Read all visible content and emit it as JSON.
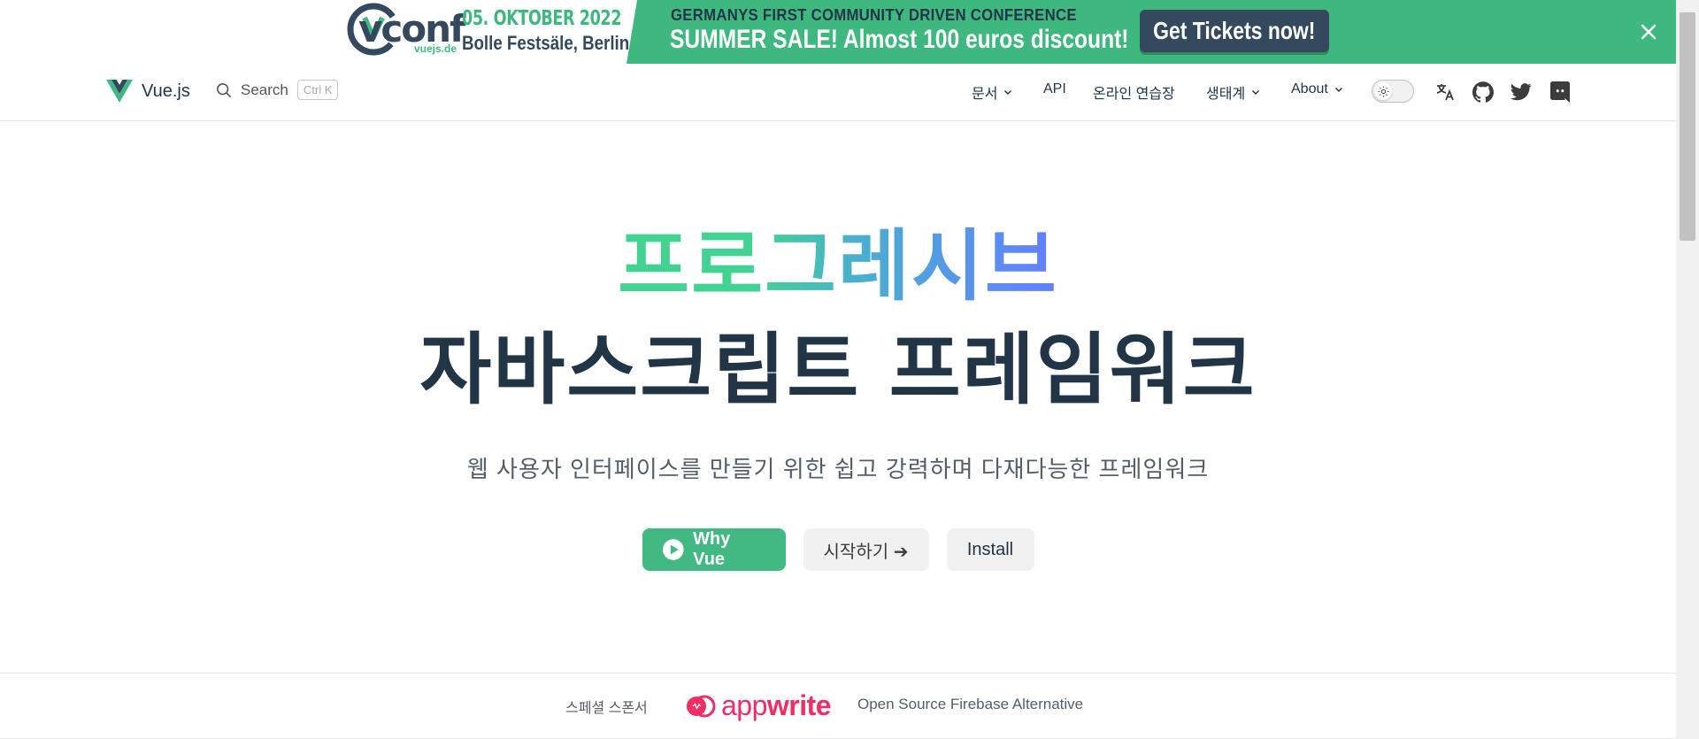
{
  "banner": {
    "logo_text": "vconf",
    "logo_sub": "vuejs.de",
    "date": "05. OKTOBER 2022",
    "venue": "Bolle Festsäle, Berlin",
    "tagline": "GERMANYS FIRST COMMUNITY DRIVEN CONFERENCE",
    "sale": "SUMMER SALE! Almost 100 euros discount!",
    "cta_label": "Get Tickets now!",
    "accent_color": "#3fb880"
  },
  "navbar": {
    "brand": "Vue.js",
    "search_label": "Search",
    "search_shortcut": "Ctrl K",
    "items": [
      {
        "label": "문서",
        "dropdown": true
      },
      {
        "label": "API",
        "dropdown": false
      },
      {
        "label": "온라인 연습장",
        "dropdown": false
      },
      {
        "label": "생태계",
        "dropdown": true
      },
      {
        "label": "About",
        "dropdown": true
      }
    ],
    "icons": [
      "sun-icon",
      "translate-icon",
      "github-icon",
      "twitter-icon",
      "discord-icon"
    ]
  },
  "hero": {
    "tagline": "프로그레시브",
    "title": "자바스크립트 프레임워크",
    "description": "웹 사용자 인터페이스를 만들기 위한 쉽고 강력하며 다재다능한 프레임워크",
    "actions": {
      "why": "Why Vue",
      "start": "시작하기 ➔",
      "install": "Install"
    }
  },
  "sponsor": {
    "label": "스페셜 스폰서",
    "brand_light": "app",
    "brand_bold": "write",
    "description": "Open Source Firebase Alternative",
    "brand_color": "#f02e65"
  },
  "colors": {
    "vue_green": "#42b883",
    "vue_dark": "#213547"
  }
}
